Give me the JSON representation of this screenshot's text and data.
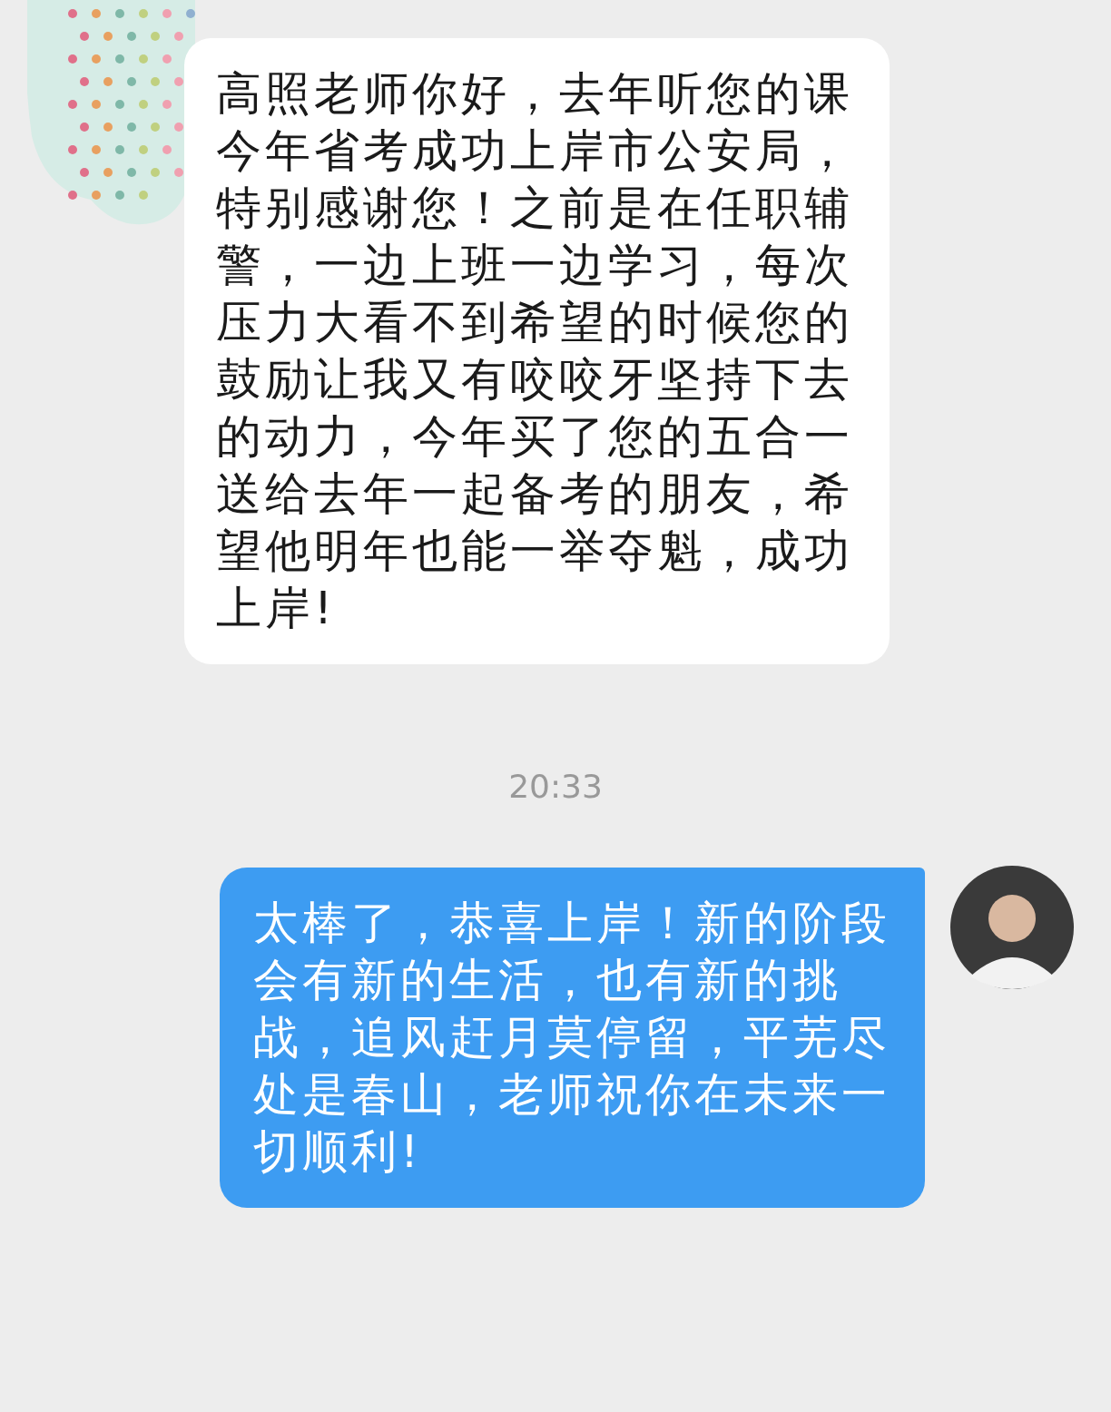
{
  "messages": [
    {
      "kind": "incoming",
      "text": "高照老师你好，去年听您的课今年省考成功上岸市公安局，特别感谢您！之前是在任职辅警，一边上班一边学习，每次压力大看不到希望的时候您的鼓励让我又有咬咬牙坚持下去的动力，今年买了您的五合一送给去年一起备考的朋友，希望他明年也能一举夺魁，成功上岸!"
    },
    {
      "kind": "timestamp",
      "text": "20:33"
    },
    {
      "kind": "outgoing",
      "text": "太棒了，恭喜上岸！新的阶段会有新的生活，也有新的挑战，追风赶月莫停留，平芜尽处是春山，老师祝你在未来一切顺利!"
    }
  ]
}
